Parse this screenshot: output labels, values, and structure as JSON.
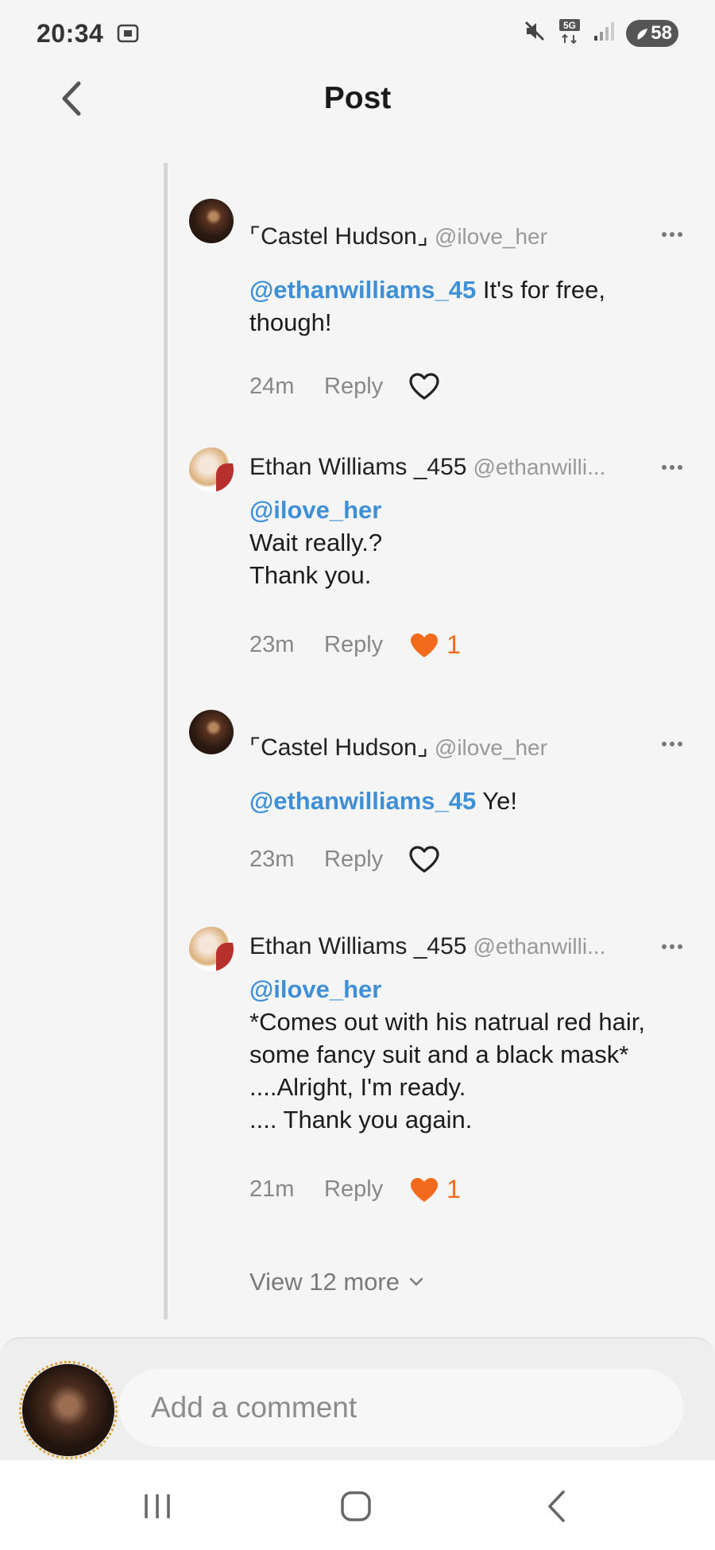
{
  "status_bar": {
    "time": "20:34",
    "battery_level": "58",
    "network": "5G"
  },
  "header": {
    "title": "Post"
  },
  "comments": [
    {
      "name": "⌜Castel Hudson⌟",
      "handle": "@ilove_her",
      "mention": "@ethanwilliams_45",
      "text": " It's for free, though!",
      "time": "24m",
      "reply_label": "Reply",
      "liked": false,
      "like_count": ""
    },
    {
      "name": "Ethan Williams _455",
      "handle": "@ethanwilli...",
      "mention": "@ilove_her",
      "lines": [
        "Wait really.?",
        "Thank you."
      ],
      "time": "23m",
      "reply_label": "Reply",
      "liked": true,
      "like_count": "1"
    },
    {
      "name": "⌜Castel Hudson⌟",
      "handle": "@ilove_her",
      "mention": "@ethanwilliams_45",
      "text": " Ye!",
      "time": "23m",
      "reply_label": "Reply",
      "liked": false,
      "like_count": ""
    },
    {
      "name": "Ethan Williams _455",
      "handle": "@ethanwilli...",
      "mention": "@ilove_her",
      "lines": [
        "*Comes out with his natrual red hair,",
        "some fancy suit and a black mask*",
        "....Alright, I'm ready.",
        ".... Thank you again."
      ],
      "time": "21m",
      "reply_label": "Reply",
      "liked": true,
      "like_count": "1"
    }
  ],
  "view_more": {
    "label": "View 12 more"
  },
  "comment_bar": {
    "placeholder": "Add a comment"
  },
  "colors": {
    "mention": "#3e8fd6",
    "like_active": "#f26b1d",
    "background": "#f5f5f5"
  },
  "icons": [
    "back-arrow-icon",
    "more-dots-icon",
    "heart-outline-icon",
    "heart-filled-icon",
    "chevron-down-icon",
    "recent-apps-icon",
    "home-icon",
    "nav-back-icon",
    "mute-icon",
    "signal-icon",
    "screenshot-icon"
  ]
}
